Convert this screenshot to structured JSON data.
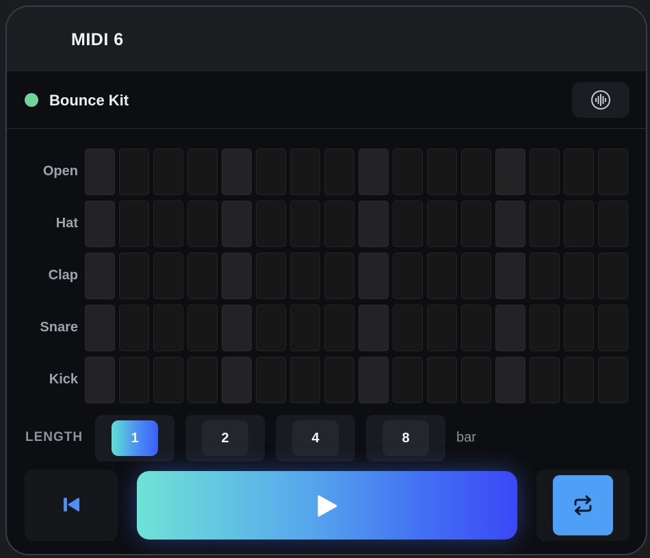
{
  "track": {
    "title": "MIDI 6"
  },
  "kit": {
    "name": "Bounce Kit",
    "status_color": "#6fd495",
    "sample_icon": "waveform-icon"
  },
  "sequencer": {
    "rows": [
      "Open",
      "Hat",
      "Clap",
      "Snare",
      "Kick"
    ],
    "steps_per_row": 16,
    "accent_every": 4
  },
  "length": {
    "label": "LENGTH",
    "options": [
      "1",
      "2",
      "4",
      "8"
    ],
    "selected": "1",
    "unit": "bar"
  },
  "transport": {
    "skip_back_icon": "skip-back-icon",
    "play_icon": "play-icon",
    "loop_icon": "loop-icon",
    "accent": "#4f9ff7"
  }
}
